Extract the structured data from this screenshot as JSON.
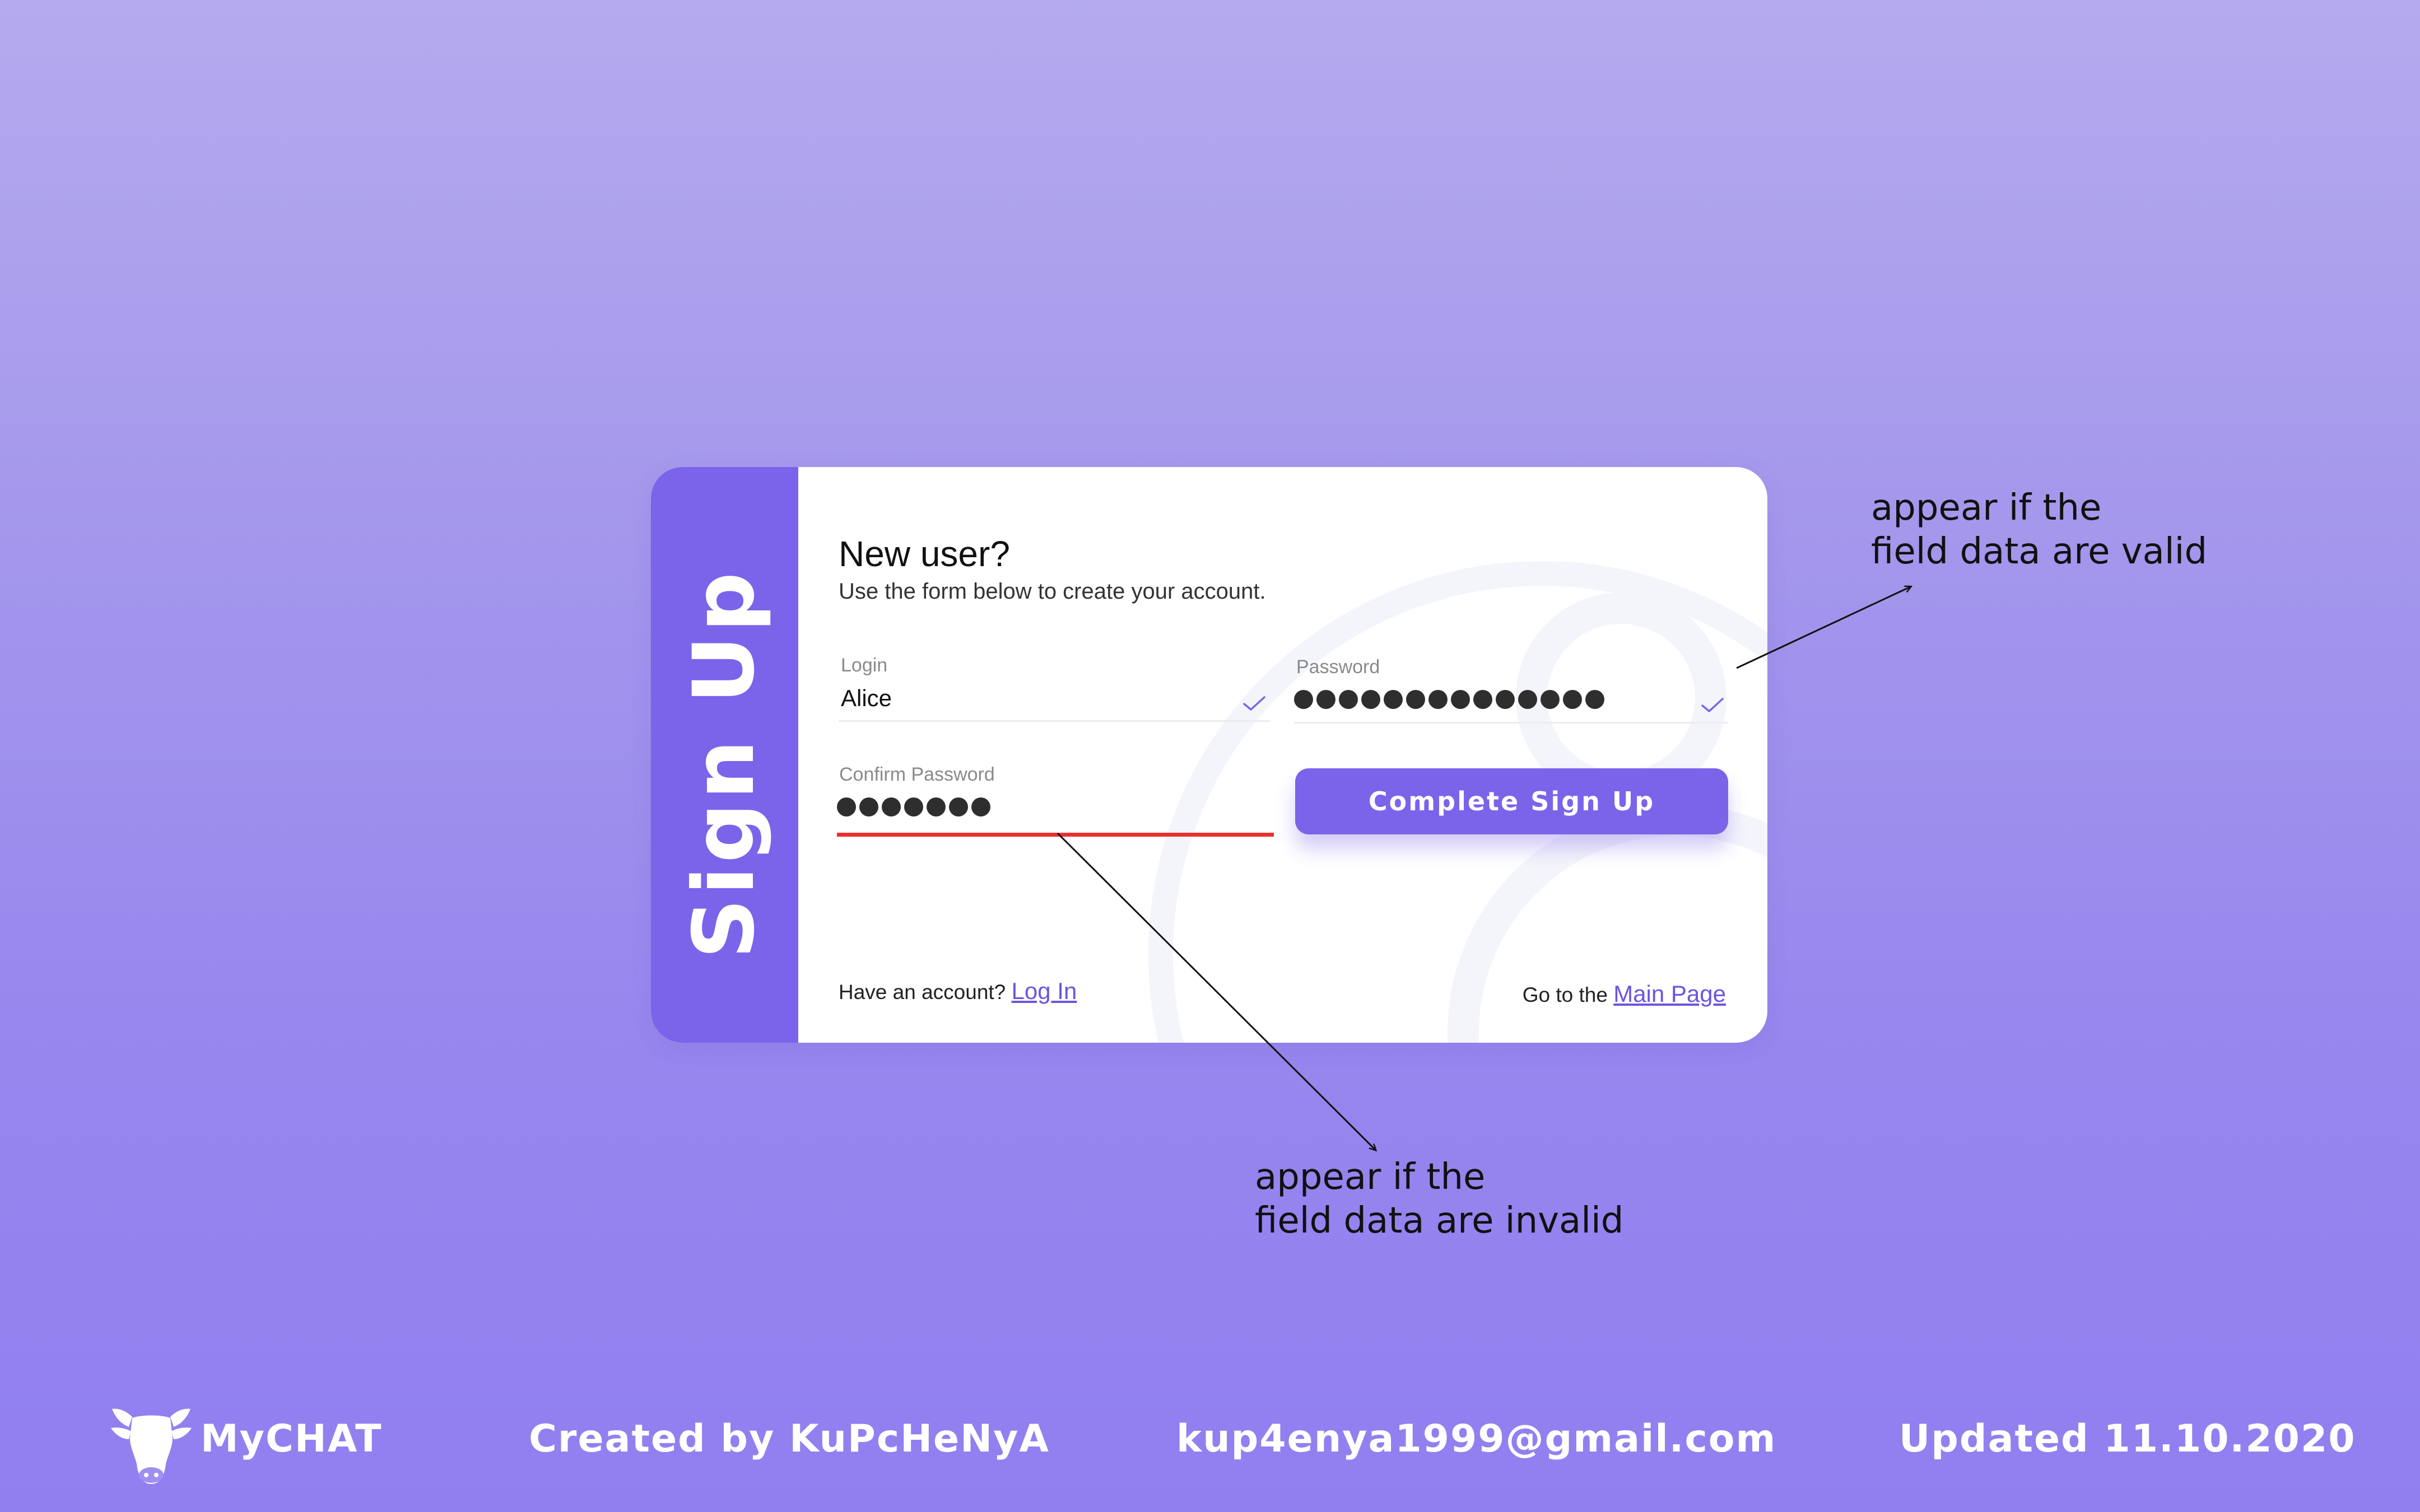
{
  "colors": {
    "accent": "#7b64ea",
    "error": "#e8302d",
    "link": "#6b55e0",
    "background_top": "#b5aaee",
    "background_bottom": "#917ff0"
  },
  "card": {
    "side_title": "Sign Up",
    "heading": "New user?",
    "subheading": "Use the form below to create your account.",
    "fields": {
      "login": {
        "label": "Login",
        "value": "Alice",
        "status_icon": "check-icon"
      },
      "password": {
        "label": "Password",
        "masked_length": 14,
        "status_icon": "check-icon"
      },
      "confirm_password": {
        "label": "Confirm Password",
        "masked_length": 7,
        "status": "invalid"
      }
    },
    "submit_label": "Complete Sign Up",
    "footer_left": {
      "text": "Have an account?",
      "link": "Log In"
    },
    "footer_right": {
      "text": "Go to the",
      "link": "Main Page"
    }
  },
  "annotations": {
    "valid": {
      "line1": "appear if the",
      "line2": "field data are valid"
    },
    "invalid": {
      "line1": "appear if the",
      "line2": "field data are invalid"
    }
  },
  "footer": {
    "logo_icon": "cow-head-icon",
    "brand": "MyCHAT",
    "credit": "Created by KuPcHeNyA",
    "email": "kup4enya1999@gmail.com",
    "updated": "Updated 11.10.2020"
  }
}
